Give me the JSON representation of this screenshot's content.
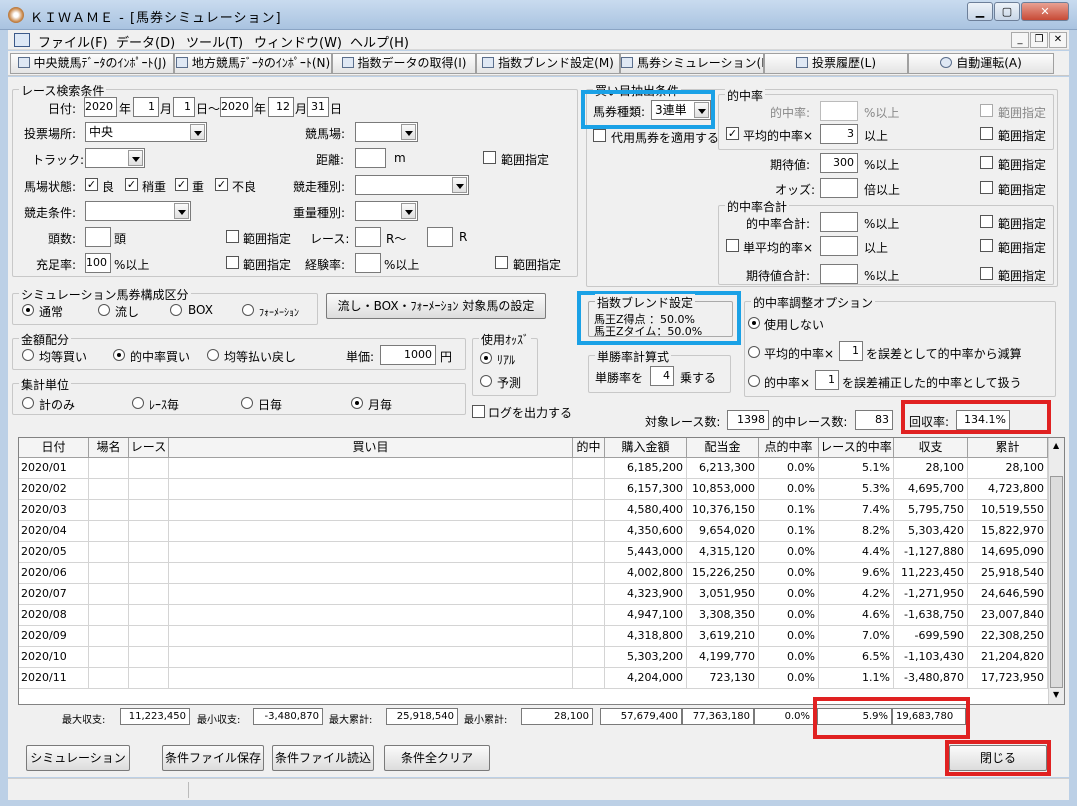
{
  "window": {
    "title": "ＫＩＷＡＭＥ - [馬券シミュレーション]"
  },
  "menu": [
    "ファイル(F)",
    "データ(D)",
    "ツール(T)",
    "ウィンドウ(W)",
    "ヘルプ(H)"
  ],
  "toolbar": [
    "中央競馬ﾃﾞｰﾀのｲﾝﾎﾟｰﾄ(J)",
    "地方競馬ﾃﾞｰﾀのｲﾝﾎﾟｰﾄ(N)",
    "指数データの取得(I)",
    "指数ブレンド設定(M)",
    "馬券シミュレーション(B)",
    "投票履歴(L)",
    "自動運転(A)"
  ],
  "race": {
    "legend": "レース検索条件",
    "date_label": "日付:",
    "from_year": "2020",
    "from_month": "1",
    "from_day": "1",
    "to_year": "2020",
    "to_month": "12",
    "to_day": "31",
    "u_year": "年",
    "u_month": "月",
    "u_day": "日",
    "tilde": "～",
    "venue_label": "投票場所:",
    "venue": "中央",
    "track_label": "競馬場:",
    "surface_label": "トラック:",
    "distance_label": "距離:",
    "distance_unit": "m",
    "range": "範囲指定",
    "condition_label": "馬場状態:",
    "cond": [
      "良",
      "稍重",
      "重",
      "不良"
    ],
    "race_type_label": "競走種別:",
    "race_cond_label": "競走条件:",
    "weight_label": "重量種別:",
    "heads_label": "頭数:",
    "heads_unit": "頭",
    "race_label": "レース:",
    "r_from": "R～",
    "r_to": "R",
    "fill_label": "充足率:",
    "fill_value": "100",
    "fill_unit": "%以上",
    "exp_label": "経験率:",
    "exp_unit": "%以上"
  },
  "buy": {
    "legend": "買い目抽出条件",
    "type_label": "馬券種類:",
    "type_value": "3連単",
    "substitute": "代用馬券を適用する",
    "hit_legend": "的中率",
    "hit_label": "的中率:",
    "pct_over": "%以上",
    "avg_hit_label": "平均的中率×",
    "avg_hit_value": "3",
    "over": "以上",
    "ev_label": "期待値:",
    "ev_value": "300",
    "odds_label": "オッズ:",
    "odds_unit": "倍以上",
    "sum_legend": "的中率合計",
    "sum_label": "的中率合計:",
    "single_avg_label": "単平均的率×",
    "ev_sum_label": "期待値合計:",
    "range": "範囲指定"
  },
  "sim": {
    "legend": "シミュレーション馬券構成区分",
    "options": [
      "通常",
      "流し",
      "BOX",
      "ﾌｫｰﾒｰｼｮﾝ"
    ],
    "flow_button": "流し・BOX・ﾌｫｰﾒｰｼｮﾝ 対象馬の設定"
  },
  "blend": {
    "legend": "指数ブレンド設定",
    "line1": "馬王Z得点 ：50.0%",
    "line2": "馬王Zタイム：50.0%"
  },
  "adjust": {
    "legend": "的中率調整オプション",
    "none": "使用しない",
    "opt2_a": "平均的中率×",
    "opt2_v": "1",
    "opt2_b": "を誤差として的中率から減算",
    "opt3_a": "的中率×",
    "opt3_v": "1",
    "opt3_b": "を誤差補正した的中率として扱う"
  },
  "amount": {
    "legend": "金額配分",
    "options": [
      "均等買い",
      "的中率買い",
      "均等払い戻し"
    ],
    "unit_label": "単価:",
    "unit_value": "1000",
    "yen": "円"
  },
  "odds": {
    "legend": "使用ｵｯｽﾞ",
    "real": "ﾘｱﾙ",
    "forecast": "予測"
  },
  "single": {
    "legend": "単勝率計算式",
    "pre": "単勝率を",
    "value": "4",
    "post": "乗する"
  },
  "agg": {
    "legend": "集計単位",
    "options": [
      "計のみ",
      "ﾚｰｽ毎",
      "日毎",
      "月毎"
    ]
  },
  "log_label": "ログを出力する",
  "summary": {
    "races_label": "対象レース数:",
    "races": "1398",
    "hit_label": "的中レース数:",
    "hit": "83",
    "roi_label": "回収率:",
    "roi": "134.1%"
  },
  "table": {
    "headers": [
      "日付",
      "場名",
      "レース",
      "買い目",
      "的中",
      "購入金額",
      "配当金",
      "点的中率",
      "レース的中率",
      "収支",
      "累計"
    ],
    "rows": [
      [
        "2020/01",
        "",
        "",
        "",
        "",
        "6,185,200",
        "6,213,300",
        "0.0%",
        "5.1%",
        "28,100",
        "28,100"
      ],
      [
        "2020/02",
        "",
        "",
        "",
        "",
        "6,157,300",
        "10,853,000",
        "0.0%",
        "5.3%",
        "4,695,700",
        "4,723,800"
      ],
      [
        "2020/03",
        "",
        "",
        "",
        "",
        "4,580,400",
        "10,376,150",
        "0.1%",
        "7.4%",
        "5,795,750",
        "10,519,550"
      ],
      [
        "2020/04",
        "",
        "",
        "",
        "",
        "4,350,600",
        "9,654,020",
        "0.1%",
        "8.2%",
        "5,303,420",
        "15,822,970"
      ],
      [
        "2020/05",
        "",
        "",
        "",
        "",
        "5,443,000",
        "4,315,120",
        "0.0%",
        "4.4%",
        "-1,127,880",
        "14,695,090"
      ],
      [
        "2020/06",
        "",
        "",
        "",
        "",
        "4,002,800",
        "15,226,250",
        "0.0%",
        "9.6%",
        "11,223,450",
        "25,918,540"
      ],
      [
        "2020/07",
        "",
        "",
        "",
        "",
        "4,323,900",
        "3,051,950",
        "0.0%",
        "4.2%",
        "-1,271,950",
        "24,646,590"
      ],
      [
        "2020/08",
        "",
        "",
        "",
        "",
        "4,947,100",
        "3,308,350",
        "0.0%",
        "4.6%",
        "-1,638,750",
        "23,007,840"
      ],
      [
        "2020/09",
        "",
        "",
        "",
        "",
        "4,318,800",
        "3,619,210",
        "0.0%",
        "7.0%",
        "-699,590",
        "22,308,250"
      ],
      [
        "2020/10",
        "",
        "",
        "",
        "",
        "5,303,200",
        "4,199,770",
        "0.0%",
        "6.5%",
        "-1,103,430",
        "21,204,820"
      ],
      [
        "2020/11",
        "",
        "",
        "",
        "",
        "4,204,000",
        "723,130",
        "0.0%",
        "1.1%",
        "-3,480,870",
        "17,723,950"
      ]
    ]
  },
  "totals": {
    "max_label": "最大収支:",
    "max": "11,223,450",
    "min_label": "最小収支:",
    "min": "-3,480,870",
    "maxc_label": "最大累計:",
    "maxc": "25,918,540",
    "minc_label": "最小累計:",
    "minc": "28,100",
    "buy": "57,679,400",
    "pay": "77,363,180",
    "point": "0.0%",
    "race": "5.9%",
    "profit": "19,683,780"
  },
  "buttons": {
    "simulate": "シミュレーション",
    "save": "条件ファイル保存",
    "load": "条件ファイル読込",
    "clear": "条件全クリア",
    "close": "閉じる"
  }
}
